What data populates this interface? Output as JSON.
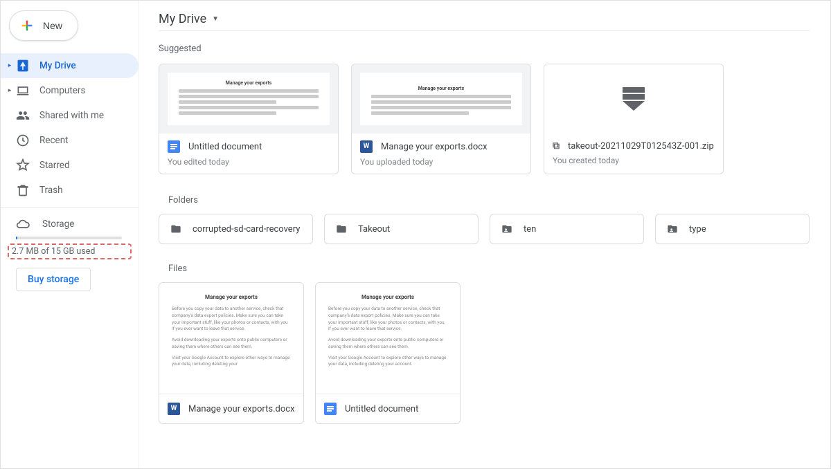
{
  "new_button": "New",
  "nav": {
    "my_drive": "My Drive",
    "computers": "Computers",
    "shared": "Shared with me",
    "recent": "Recent",
    "starred": "Starred",
    "trash": "Trash",
    "storage": "Storage"
  },
  "storage_text": "2.7 MB of 15 GB used",
  "buy_storage": "Buy storage",
  "breadcrumb": "My Drive",
  "suggested_title": "Suggested",
  "suggested": [
    {
      "doc_heading": "Manage your exports",
      "name": "Untitled document",
      "sub": "You edited today",
      "type": "docs"
    },
    {
      "doc_heading": "Manage your exports",
      "name": "Manage your exports.docx",
      "sub": "You uploaded today",
      "type": "word"
    },
    {
      "name": "takeout-20211029T012543Z-001.zip",
      "sub": "You created today",
      "type": "zip"
    }
  ],
  "folders_title": "Folders",
  "folders": [
    {
      "name": "corrupted-sd-card-recovery",
      "type": "plain"
    },
    {
      "name": "Takeout",
      "type": "plain"
    },
    {
      "name": "ten",
      "type": "shared"
    },
    {
      "name": "type",
      "type": "shared"
    }
  ],
  "files_title": "Files",
  "files": [
    {
      "doc_heading": "Manage your exports",
      "name": "Manage your exports.docx",
      "type": "word"
    },
    {
      "doc_heading": "Manage your exports",
      "name": "Untitled document",
      "type": "docs"
    }
  ]
}
